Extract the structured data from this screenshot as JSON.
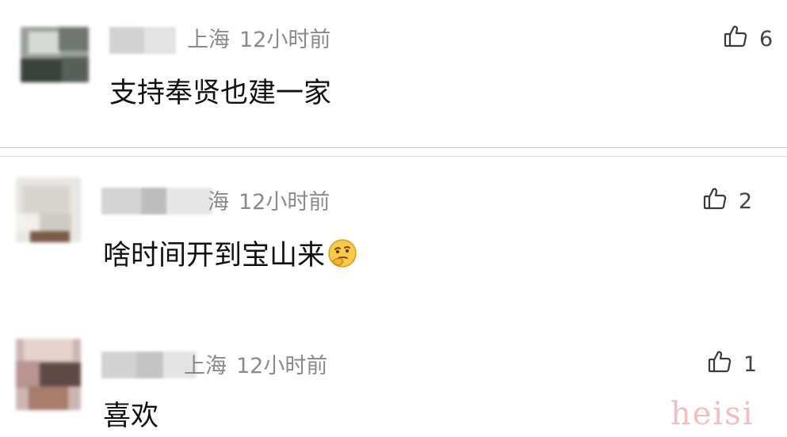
{
  "comments": [
    {
      "location": "上海",
      "time": "12小时前",
      "text": "支持奉贤也建一家",
      "likes": "6"
    },
    {
      "location": "海",
      "time": "12小时前",
      "text": "啥时间开到宝山来",
      "emoji": "thinking-face-emoji",
      "likes": "2"
    },
    {
      "location": "上海",
      "time": "12小时前",
      "text": "喜欢",
      "likes": "1"
    }
  ],
  "watermark": "heisi",
  "icons": {
    "like": "thumbs-up-icon"
  },
  "colors": {
    "meta_gray": "#8a8a8a",
    "divider": "#c9c9c9",
    "watermark": "#f3b8b8"
  }
}
